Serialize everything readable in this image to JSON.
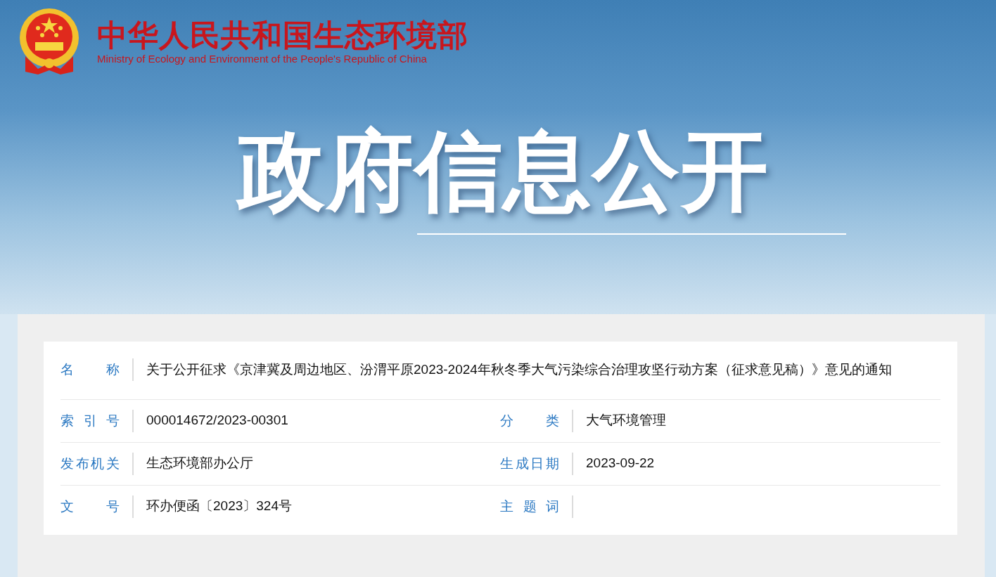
{
  "header": {
    "title": "中华人民共和国生态环境部",
    "subtitle": "Ministry of Ecology and Environment of the People's Republic of China"
  },
  "banner": {
    "title": "政府信息公开"
  },
  "info": {
    "rows": [
      {
        "fields": [
          {
            "label": "名称",
            "value": "关于公开征求《京津冀及周边地区、汾渭平原2023-2024年秋冬季大气污染综合治理攻坚行动方案（征求意见稿）》意见的通知"
          }
        ]
      },
      {
        "fields": [
          {
            "label": "索引号",
            "value": "000014672/2023-00301"
          },
          {
            "label": "分类",
            "value": "大气环境管理"
          }
        ]
      },
      {
        "fields": [
          {
            "label": "发布机关",
            "value": "生态环境部办公厅"
          },
          {
            "label": "生成日期",
            "value": "2023-09-22"
          }
        ]
      },
      {
        "fields": [
          {
            "label": "文号",
            "value": "环办便函〔2023〕324号"
          },
          {
            "label": "主题词"
          }
        ]
      }
    ]
  }
}
